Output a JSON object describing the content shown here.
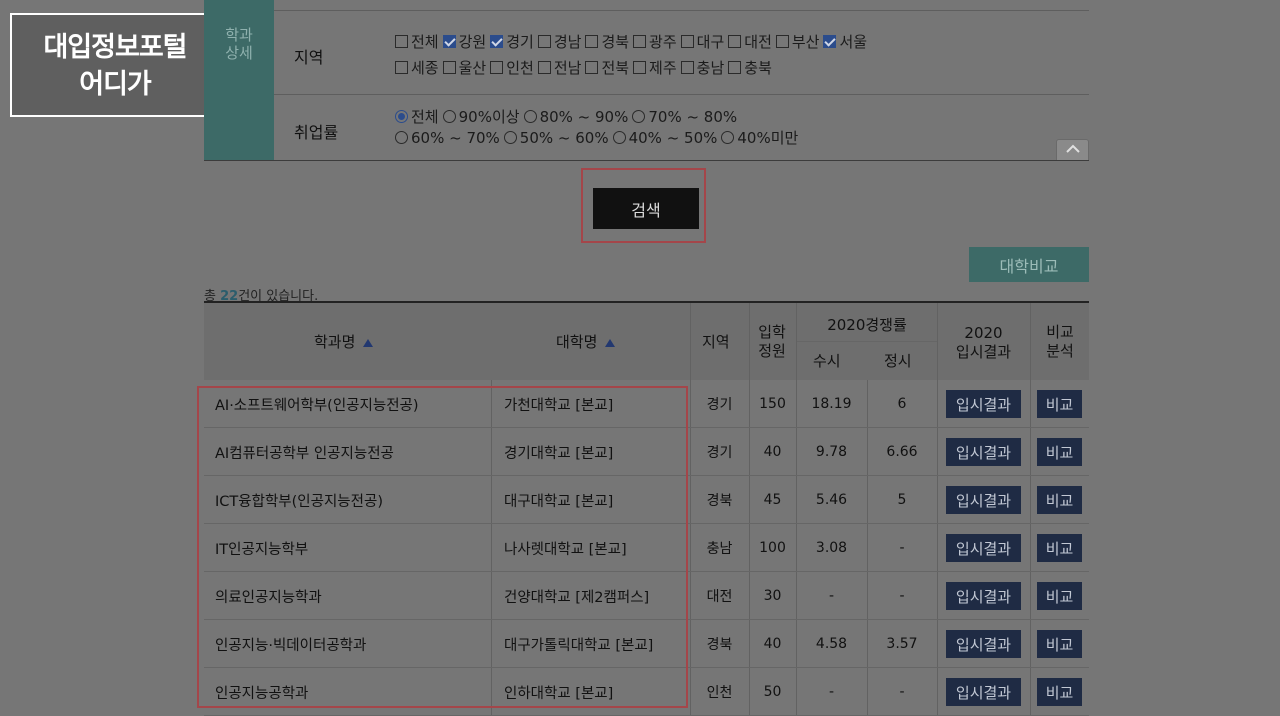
{
  "logo": {
    "line1": "대입정보포털",
    "line2": "어디가"
  },
  "filter": {
    "side_tab": [
      "학과",
      "상세"
    ],
    "region_label": "지역",
    "regions_row1": [
      {
        "label": "전체",
        "checked": false
      },
      {
        "label": "강원",
        "checked": true
      },
      {
        "label": "경기",
        "checked": true
      },
      {
        "label": "경남",
        "checked": false
      },
      {
        "label": "경북",
        "checked": false
      },
      {
        "label": "광주",
        "checked": false
      },
      {
        "label": "대구",
        "checked": false
      },
      {
        "label": "대전",
        "checked": false
      },
      {
        "label": "부산",
        "checked": false
      },
      {
        "label": "서울",
        "checked": true
      }
    ],
    "regions_row2": [
      {
        "label": "세종",
        "checked": false
      },
      {
        "label": "울산",
        "checked": false
      },
      {
        "label": "인천",
        "checked": false
      },
      {
        "label": "전남",
        "checked": false
      },
      {
        "label": "전북",
        "checked": false
      },
      {
        "label": "제주",
        "checked": false
      },
      {
        "label": "충남",
        "checked": false
      },
      {
        "label": "충북",
        "checked": false
      }
    ],
    "employment_label": "취업률",
    "employment_row1": [
      {
        "label": "전체",
        "selected": true
      },
      {
        "label": "90%이상",
        "selected": false
      },
      {
        "label": "80% ~ 90%",
        "selected": false
      },
      {
        "label": "70% ~ 80%",
        "selected": false
      }
    ],
    "employment_row2": [
      {
        "label": "60% ~ 70%",
        "selected": false
      },
      {
        "label": "50% ~ 60%",
        "selected": false
      },
      {
        "label": "40% ~ 50%",
        "selected": false
      },
      {
        "label": "40%미만",
        "selected": false
      }
    ],
    "collapse_icon": "chevron-up-icon"
  },
  "search_label": "검색",
  "compare_univ_label": "대학비교",
  "result_count": {
    "prefix": "총 ",
    "count": "22",
    "suffix": "건이 있습니다."
  },
  "table": {
    "headers": {
      "dept": "학과명",
      "univ": "대학명",
      "region": "지역",
      "capacity": [
        "입학",
        "정원"
      ],
      "competition": "2020경쟁률",
      "susi": "수시",
      "jeongsi": "정시",
      "result": [
        "2020",
        "입시결과"
      ],
      "compare": [
        "비교",
        "분석"
      ]
    },
    "rows": [
      {
        "dept": "AI·소프트웨어학부(인공지능전공)",
        "univ": "가천대학교 [본교]",
        "region": "경기",
        "capacity": "150",
        "susi": "18.19",
        "jeongsi": "6",
        "result_label": "입시결과",
        "compare_label": "비교"
      },
      {
        "dept": "AI컴퓨터공학부 인공지능전공",
        "univ": "경기대학교 [본교]",
        "region": "경기",
        "capacity": "40",
        "susi": "9.78",
        "jeongsi": "6.66",
        "result_label": "입시결과",
        "compare_label": "비교"
      },
      {
        "dept": "ICT융합학부(인공지능전공)",
        "univ": "대구대학교 [본교]",
        "region": "경북",
        "capacity": "45",
        "susi": "5.46",
        "jeongsi": "5",
        "result_label": "입시결과",
        "compare_label": "비교"
      },
      {
        "dept": "IT인공지능학부",
        "univ": "나사렛대학교 [본교]",
        "region": "충남",
        "capacity": "100",
        "susi": "3.08",
        "jeongsi": "-",
        "result_label": "입시결과",
        "compare_label": "비교"
      },
      {
        "dept": "의료인공지능학과",
        "univ": "건양대학교 [제2캠퍼스]",
        "region": "대전",
        "capacity": "30",
        "susi": "-",
        "jeongsi": "-",
        "result_label": "입시결과",
        "compare_label": "비교"
      },
      {
        "dept": "인공지능·빅데이터공학과",
        "univ": "대구가톨릭대학교 [본교]",
        "region": "경북",
        "capacity": "40",
        "susi": "4.58",
        "jeongsi": "3.57",
        "result_label": "입시결과",
        "compare_label": "비교"
      },
      {
        "dept": "인공지능공학과",
        "univ": "인하대학교 [본교]",
        "region": "인천",
        "capacity": "50",
        "susi": "-",
        "jeongsi": "-",
        "result_label": "입시결과",
        "compare_label": "비교"
      }
    ]
  }
}
